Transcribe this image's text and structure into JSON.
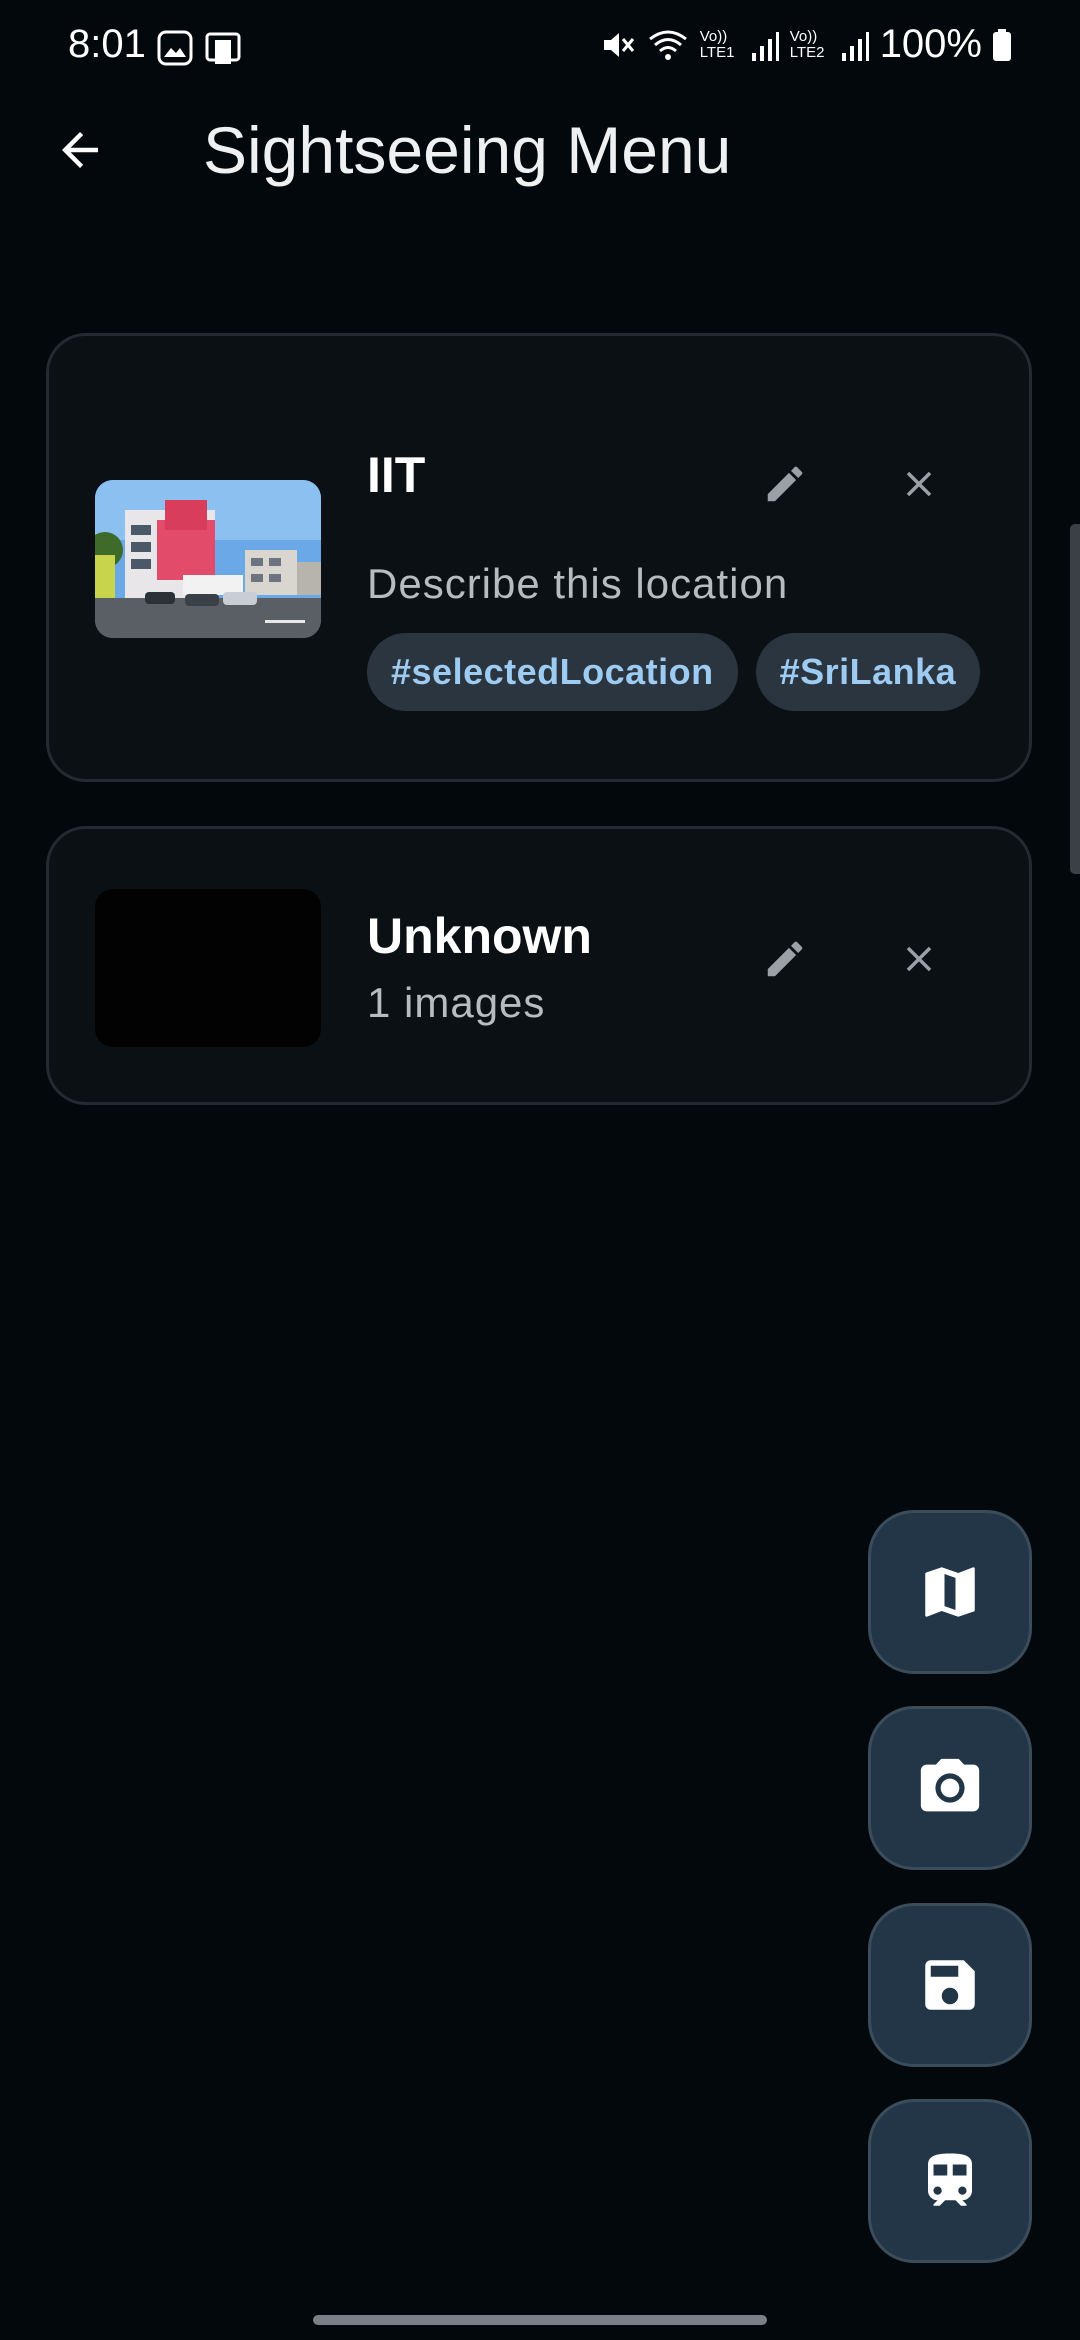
{
  "status_bar": {
    "time": "8:01",
    "battery": "100%",
    "sim1_label_top": "Vo))",
    "sim1_label_bottom": "LTE1",
    "sim2_label_top": "Vo))",
    "sim2_label_bottom": "LTE2"
  },
  "app_bar": {
    "title": "Sightseeing Menu",
    "back_icon": "arrow-back-icon"
  },
  "locations": [
    {
      "title": "IIT",
      "description": "Describe this location",
      "tags": [
        "#selectedLocation",
        "#SriLanka"
      ],
      "thumbnail": "building-photo"
    },
    {
      "title": "Unknown",
      "subtitle": "1 images",
      "thumbnail": "dark-image"
    }
  ],
  "fabs": [
    {
      "icon": "map-icon"
    },
    {
      "icon": "camera-icon"
    },
    {
      "icon": "save-icon"
    },
    {
      "icon": "train-icon"
    }
  ],
  "colors": {
    "background": "#03080c",
    "card": "#0b1014",
    "chip_bg": "#2a3540",
    "chip_text": "#9ecbf2",
    "fab_bg": "#223648"
  }
}
